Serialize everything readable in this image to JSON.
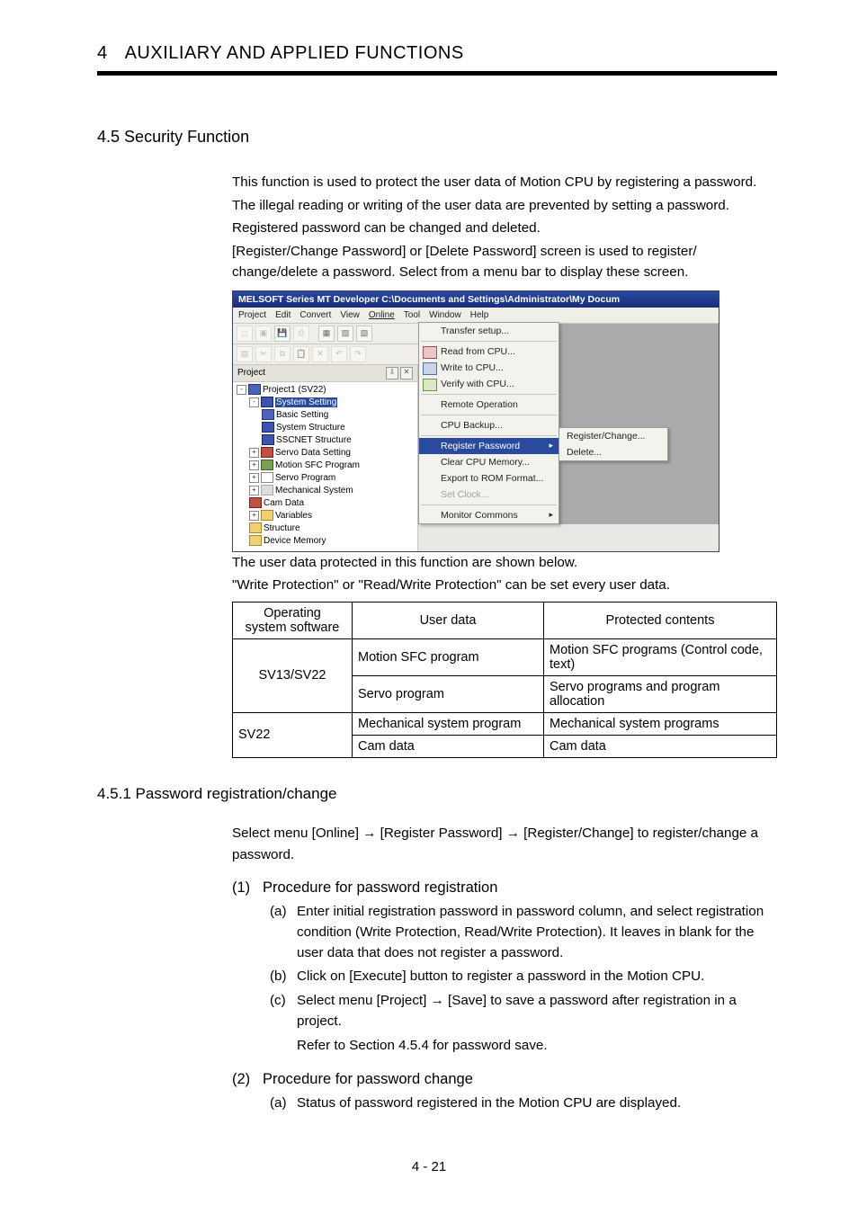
{
  "header": {
    "chapter_num": "4",
    "chapter_title": "AUXILIARY AND APPLIED FUNCTIONS"
  },
  "section": {
    "num": "4.5",
    "title": "Security Function"
  },
  "intro": {
    "p1": "This function is used to protect the user data of Motion CPU by registering a password.",
    "p2": "The illegal reading or writing of the user data are prevented by setting a password.",
    "p3": "Registered password can be changed and deleted.",
    "p4": "[Register/Change Password] or [Delete Password] screen is used to register/ change/delete a password. Select from a menu bar to display these screen."
  },
  "app": {
    "title": "MELSOFT Series MT Developer  C:\\Documents and Settings\\Administrator\\My Docum",
    "menubar": [
      "Project",
      "Edit",
      "Convert",
      "View",
      "Online",
      "Tool",
      "Window",
      "Help"
    ],
    "online_items": {
      "transfer": "Transfer setup...",
      "read": "Read from CPU...",
      "write": "Write to CPU...",
      "verify": "Verify with CPU...",
      "remote": "Remote Operation",
      "backup": "CPU Backup...",
      "register": "Register Password",
      "clear": "Clear CPU Memory...",
      "export": "Export to ROM Format...",
      "setclock": "Set Clock...",
      "monitor": "Monitor Commons"
    },
    "submenu": {
      "reg": "Register/Change...",
      "del": "Delete..."
    },
    "panel_title": "Project",
    "tree": {
      "root": "Project1 (SV22)",
      "syssetting": "System Setting",
      "basic": "Basic Setting",
      "sysstruct": "System Structure",
      "sscnet": "SSCNET Structure",
      "servo_data": "Servo Data Setting",
      "sfc": "Motion SFC Program",
      "servo_prog": "Servo Program",
      "mech": "Mechanical System",
      "cam": "Cam Data",
      "vars": "Variables",
      "struct": "Structure",
      "devmem": "Device Memory"
    }
  },
  "mid": {
    "p1": "The user data protected in this function are shown below.",
    "p2": "\"Write Protection\" or \"Read/Write Protection\" can be set every user data."
  },
  "table": {
    "h1a": "Operating",
    "h1b": "system software",
    "h2": "User data",
    "h3": "Protected contents",
    "r1c1": "SV13/SV22",
    "r1c2": "Motion SFC program",
    "r1c3": "Motion SFC programs (Control code, text)",
    "r2c2": "Servo program",
    "r2c3": "Servo programs and program allocation",
    "r3c1": "SV22",
    "r3c2": "Mechanical system program",
    "r3c3": "Mechanical system programs",
    "r4c2": "Cam data",
    "r4c3": "Cam data"
  },
  "subsection": {
    "num": "4.5.1",
    "title": "Password registration/change"
  },
  "sub_intro": "Select menu [Online] → [Register Password] → [Register/Change] to register/change a password.",
  "proc1": {
    "num": "(1)",
    "title": "Procedure for password registration",
    "a_n": "(a)",
    "a": "Enter initial registration password in password column, and select registration condition (Write Protection, Read/Write Protection). It leaves in blank for the user data that does not register a password.",
    "b_n": "(b)",
    "b": "Click on [Execute] button to register a password in the Motion CPU.",
    "c_n": "(c)",
    "c": "Select menu [Project] → [Save] to save a password after registration in a project.",
    "c2": "Refer to Section 4.5.4 for password save."
  },
  "proc2": {
    "num": "(2)",
    "title": "Procedure for password change",
    "a_n": "(a)",
    "a": "Status of password registered in the Motion CPU are displayed."
  },
  "footer": {
    "page": "4 - 21"
  }
}
